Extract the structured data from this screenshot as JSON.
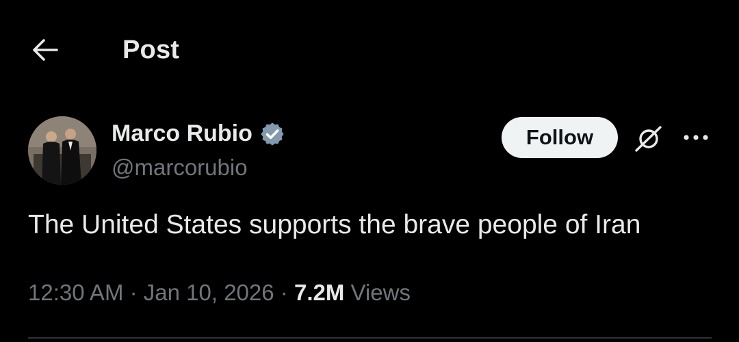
{
  "header": {
    "back_icon": "arrow-left-icon",
    "title": "Post"
  },
  "post": {
    "author": {
      "name": "Marco Rubio",
      "handle": "@marcorubio",
      "verified_icon": "verified-badge-icon",
      "verified_color": "#829aab"
    },
    "follow_label": "Follow",
    "grok_icon": "grok-icon",
    "more_icon": "more-horizontal-icon",
    "text": "The United States supports the brave people of Iran",
    "time": "12:30 AM",
    "separator": "·",
    "date": "Jan 10, 2026",
    "views_count": "7.2M",
    "views_label": "Views"
  },
  "colors": {
    "background": "#000000",
    "primary_text": "#e7e9ea",
    "secondary_text": "#71767b",
    "follow_bg": "#eff3f4",
    "divider": "#2f3336"
  }
}
